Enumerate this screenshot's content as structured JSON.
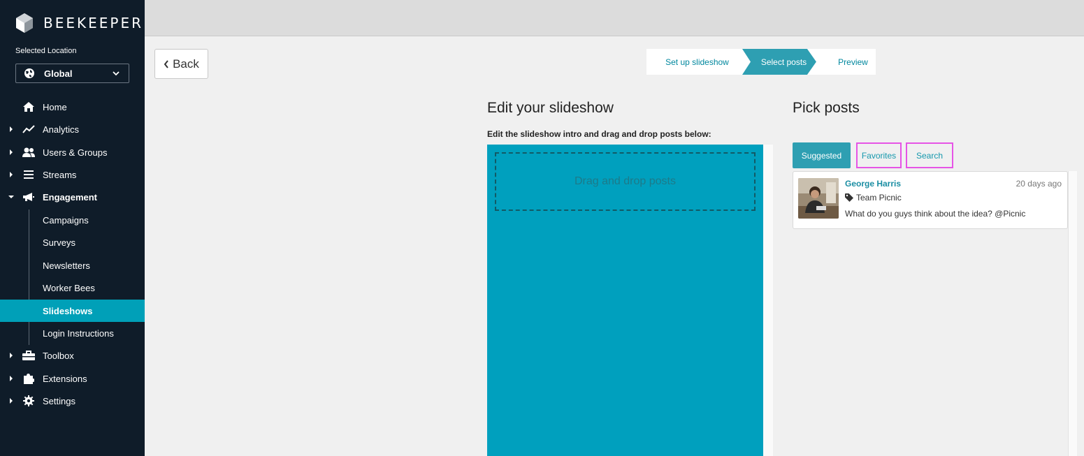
{
  "brand": {
    "name": "BEEKEEPER"
  },
  "location": {
    "label": "Selected Location",
    "value": "Global"
  },
  "nav": {
    "home": "Home",
    "analytics": "Analytics",
    "users_groups": "Users & Groups",
    "streams": "Streams",
    "engagement": "Engagement",
    "campaigns": "Campaigns",
    "surveys": "Surveys",
    "newsletters": "Newsletters",
    "worker_bees": "Worker Bees",
    "slideshows": "Slideshows",
    "login_instructions": "Login Instructions",
    "toolbox": "Toolbox",
    "extensions": "Extensions",
    "settings": "Settings"
  },
  "back_button": {
    "label": "Back"
  },
  "steps": [
    "Set up slideshow",
    "Select posts",
    "Preview"
  ],
  "editor": {
    "title": "Edit your slideshow",
    "subtitle": "Edit the slideshow intro and drag and drop posts below:",
    "dropzone": "Drag and drop posts"
  },
  "picker": {
    "title": "Pick posts",
    "tabs": {
      "suggested": "Suggested",
      "favorites": "Favorites",
      "search": "Search"
    },
    "posts": [
      {
        "author": "George Harris",
        "time": "20 days ago",
        "tag": "Team Picnic",
        "text": "What do you guys think about the idea? @Picnic"
      }
    ]
  },
  "colors": {
    "sidebar": "#0f1c29",
    "accent": "#00a0b8",
    "step_active": "#2e9fb2",
    "highlight": "#e654e6"
  }
}
